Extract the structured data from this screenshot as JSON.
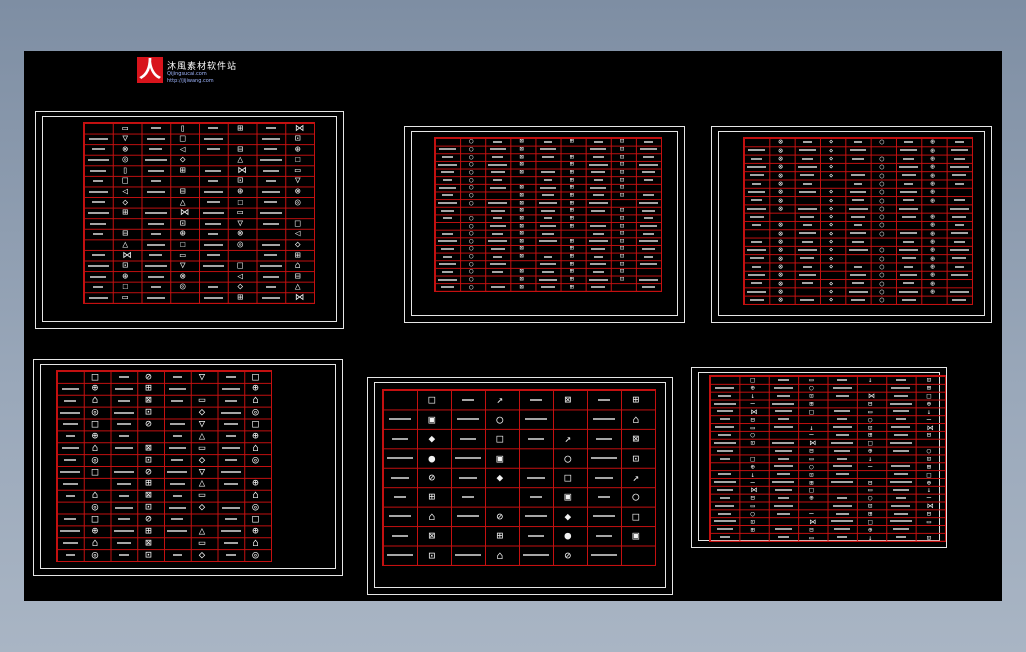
{
  "watermark": {
    "mark": "人",
    "name": "沐風素材软件站",
    "sub": "Qijingsucai.com",
    "url": "http://jijiwang.com"
  },
  "colors": {
    "grid": "#c41010",
    "frame": "#e6e6e6",
    "background": "#000000"
  },
  "sheets": [
    {
      "name": "sheet-1",
      "cols": 8,
      "rows": 17,
      "glyphs": [
        "□",
        "⊕",
        "◇",
        "▭",
        "⌂",
        "⊗",
        "△",
        "▯",
        "⊡",
        "◁",
        "☐",
        "⊞",
        "▽",
        "⊟",
        "◎",
        "⋈"
      ]
    },
    {
      "name": "sheet-2",
      "cols": 9,
      "rows": 20,
      "glyphs": [
        "▭",
        "⊞",
        "□",
        "◯",
        "⊟",
        "⊡",
        "▯",
        "⊠",
        "⊕",
        "—"
      ]
    },
    {
      "name": "sheet-3",
      "cols": 9,
      "rows": 20,
      "glyphs": [
        "↓",
        "◯",
        "□",
        "⊗",
        "◇",
        "⊕",
        "⊡",
        "⋄",
        "▽",
        "⊞"
      ]
    },
    {
      "name": "sheet-4",
      "cols": 8,
      "rows": 16,
      "glyphs": [
        "⊕",
        "⊠",
        "◇",
        "□",
        "⊞",
        "▭",
        "◎",
        "⊘",
        "△",
        "⌂",
        "⊡",
        "▽"
      ]
    },
    {
      "name": "sheet-5",
      "cols": 8,
      "rows": 9,
      "glyphs": [
        "⊠",
        "▣",
        "⌂",
        "□",
        "⊞",
        "◯",
        "⊘",
        "↗",
        "●",
        "⊡",
        "◆"
      ]
    },
    {
      "name": "sheet-6",
      "cols": 8,
      "rows": 21,
      "glyphs": [
        "─",
        "↓",
        "⊕",
        "□",
        "⊞",
        "⊡",
        "◯",
        "▭",
        "⊟",
        "⋈"
      ]
    }
  ]
}
